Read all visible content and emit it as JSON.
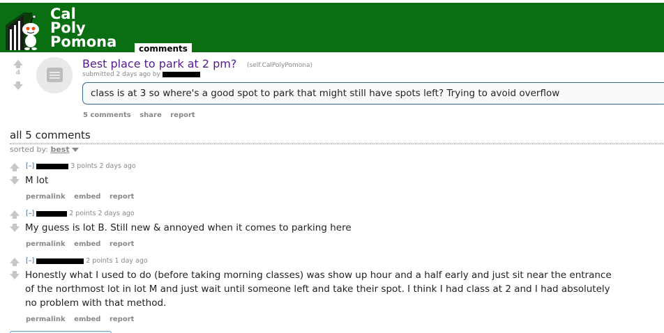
{
  "header": {
    "logo_lines": [
      "Cal",
      "Poly",
      "Pomona"
    ],
    "tab_label": "comments",
    "color": "#0a6e12"
  },
  "post": {
    "score": "4",
    "title": "Best place to park at 2 pm?",
    "domain": "(self.CalPolyPomona)",
    "tagline": "submitted 2 days ago by",
    "selftext": "class is at 3 so where's a good spot to park that might still have spots left? Trying to avoid overflow",
    "buttons": [
      "5 comments",
      "share",
      "report"
    ]
  },
  "comments_section": {
    "heading": "all 5 comments",
    "sorted_label": "sorted by:",
    "sort_value": "best"
  },
  "comments": [
    {
      "toggle": "[–]",
      "meta": "3 points 2 days ago",
      "body": "M lot",
      "buttons": [
        "permalink",
        "embed",
        "report"
      ]
    },
    {
      "toggle": "[–]",
      "meta": "2 points 2 days ago",
      "body": "My guess is lot B. Still new & annoyed when it comes to parking here",
      "buttons": [
        "permalink",
        "embed",
        "report"
      ]
    },
    {
      "toggle": "[–]",
      "meta": "2 points 1 day ago",
      "body": "Honestly what I used to do (before taking morning classes) was show up hour and a half early and just sit near the entrance of the northmost lot in lot M and just wait until someone left and take their spot. I think I had class at 2 and I had absolutely no problem with that method.",
      "buttons": [
        "permalink",
        "embed",
        "report"
      ]
    }
  ]
}
